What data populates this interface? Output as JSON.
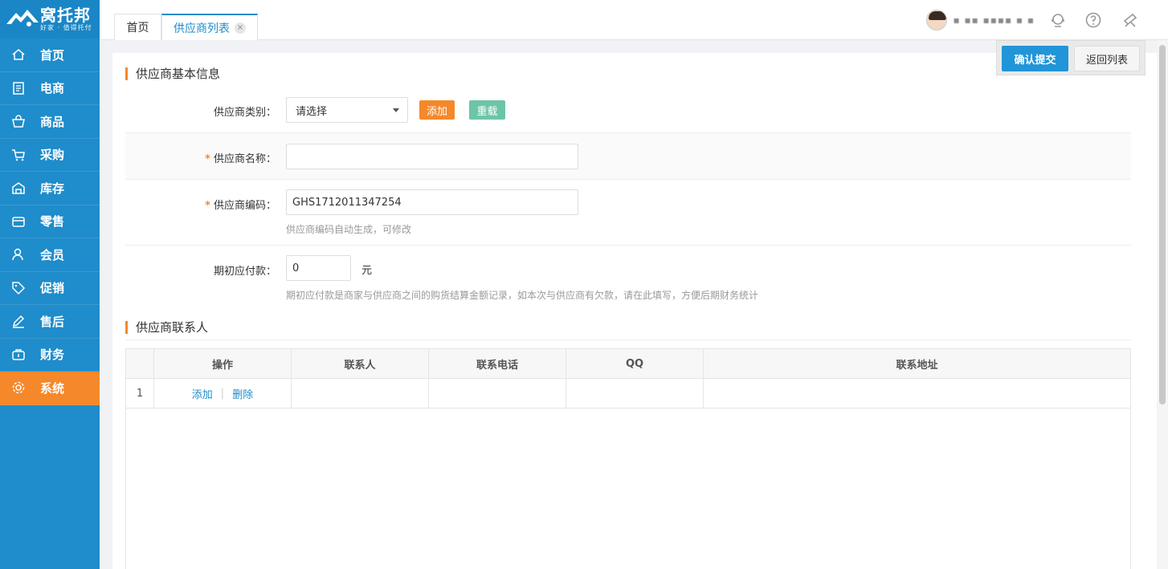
{
  "app": {
    "logo_title": "窝托邦",
    "logo_sub": "好家 · 值得托付"
  },
  "colors": {
    "primary": "#1f8ccb",
    "accent": "#f5882a",
    "reload": "#6cc5a9"
  },
  "sidebar": {
    "items": [
      {
        "label": "首页",
        "icon": "home-icon"
      },
      {
        "label": "电商",
        "icon": "document-icon"
      },
      {
        "label": "商品",
        "icon": "bag-icon"
      },
      {
        "label": "采购",
        "icon": "cart-icon"
      },
      {
        "label": "库存",
        "icon": "warehouse-icon"
      },
      {
        "label": "零售",
        "icon": "store-icon"
      },
      {
        "label": "会员",
        "icon": "member-icon"
      },
      {
        "label": "促销",
        "icon": "tag-icon"
      },
      {
        "label": "售后",
        "icon": "pen-icon"
      },
      {
        "label": "财务",
        "icon": "finance-icon"
      },
      {
        "label": "系统",
        "icon": "gear-icon",
        "active": true
      }
    ]
  },
  "tabs": {
    "home": "首页",
    "active": "供应商列表",
    "close": "×"
  },
  "header": {
    "username": "▪ ▪▪ ▪▪▪▪ ▪ ▪"
  },
  "actions": {
    "submit": "确认提交",
    "back": "返回列表"
  },
  "form": {
    "section_basic": "供应商基本信息",
    "category_label": "供应商类别：",
    "category_value": "请选择",
    "add_label": "添加",
    "reload_label": "重载",
    "required_mark": "*",
    "name_label": "供应商名称：",
    "name_value": "",
    "code_label": "供应商编码：",
    "code_value": "GHS1712011347254",
    "code_hint": "供应商编码自动生成，可修改",
    "payable_label": "期初应付款：",
    "payable_value": "0",
    "payable_unit": "元",
    "payable_hint": "期初应付款是商家与供应商之间的购货结算金额记录，如本次与供应商有欠款，请在此填写，方便后期财务统计"
  },
  "contacts": {
    "section_title": "供应商联系人",
    "columns": [
      "",
      "操作",
      "联系人",
      "联系电话",
      "QQ",
      "联系地址"
    ],
    "rows": [
      {
        "index": "1",
        "add": "添加",
        "delete": "删除",
        "divider": "|",
        "contact": "",
        "phone": "",
        "qq": "",
        "address": ""
      }
    ]
  }
}
